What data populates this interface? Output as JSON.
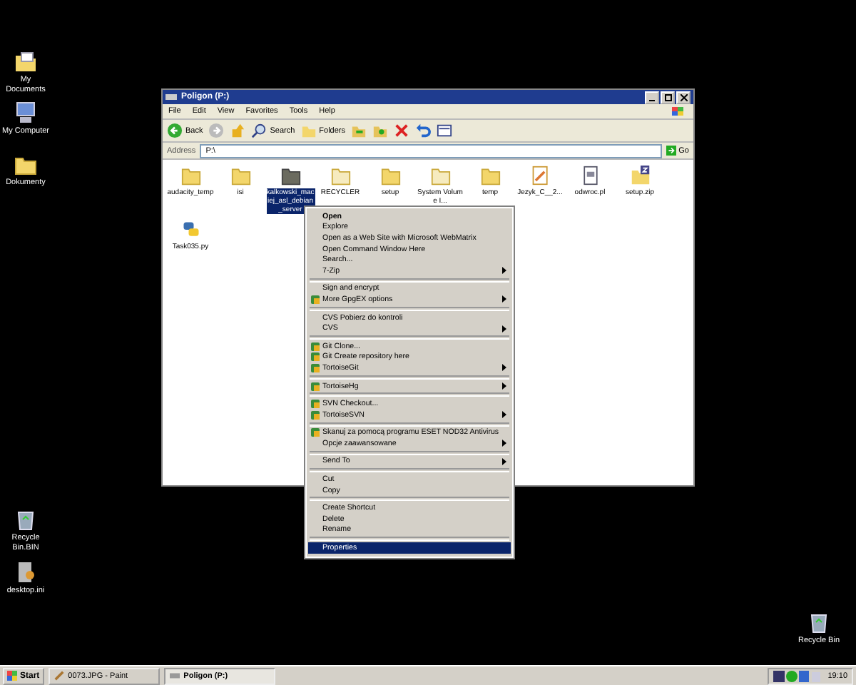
{
  "desktop_icons": [
    {
      "label": "My Documents",
      "kind": "documents"
    },
    {
      "label": "My Computer",
      "kind": "computer"
    },
    {
      "label": "Dokumenty",
      "kind": "folder"
    },
    {
      "label": "Recycle Bin.BIN",
      "kind": "bin"
    },
    {
      "label": "desktop.ini",
      "kind": "settings-file"
    },
    {
      "label": "Recycle Bin",
      "kind": "bin"
    }
  ],
  "window": {
    "title": "Poligon (P:)",
    "menu": [
      "File",
      "Edit",
      "View",
      "Favorites",
      "Tools",
      "Help"
    ],
    "toolbar": [
      {
        "kind": "back",
        "label": "Back"
      },
      {
        "kind": "forward"
      },
      {
        "kind": "up"
      },
      {
        "kind": "search",
        "label": "Search"
      },
      {
        "kind": "folders",
        "label": "Folders"
      },
      {
        "kind": "move"
      },
      {
        "kind": "copy"
      },
      {
        "kind": "delete"
      },
      {
        "kind": "undo"
      },
      {
        "kind": "views"
      }
    ],
    "address": {
      "label": "Address",
      "value": "P:\\",
      "go": "Go"
    },
    "files": [
      {
        "label": "audacity_temp",
        "kind": "folder",
        "selected": false
      },
      {
        "label": "isi",
        "kind": "folder",
        "selected": false
      },
      {
        "label": "kalkowski_maciej_asl_debian_server",
        "kind": "folder",
        "selected": true
      },
      {
        "label": "RECYCLER",
        "kind": "folder-faded",
        "selected": false
      },
      {
        "label": "setup",
        "kind": "folder",
        "selected": false
      },
      {
        "label": "System Volume I...",
        "kind": "folder-faded",
        "selected": false
      },
      {
        "label": "temp",
        "kind": "folder",
        "selected": false
      },
      {
        "label": "Jezyk_C__2...",
        "kind": "document",
        "selected": false
      },
      {
        "label": "odwroc.pl",
        "kind": "text",
        "selected": false
      },
      {
        "label": "setup.zip",
        "kind": "zip",
        "selected": false
      },
      {
        "label": "Task035.py",
        "kind": "python",
        "selected": false
      }
    ]
  },
  "context_menu": [
    {
      "kind": "item",
      "label": "Open",
      "bold": true,
      "selected": false
    },
    {
      "kind": "item",
      "label": "Explore",
      "selected": false
    },
    {
      "kind": "item",
      "label": "Open as a Web Site with Microsoft WebMatrix",
      "selected": false
    },
    {
      "kind": "item",
      "label": "Open Command Window Here",
      "selected": false
    },
    {
      "kind": "item",
      "label": "Search...",
      "selected": false
    },
    {
      "kind": "item",
      "label": "7-Zip",
      "submenu": true,
      "selected": false
    },
    {
      "kind": "separator"
    },
    {
      "kind": "item",
      "label": "Sign and encrypt",
      "selected": false
    },
    {
      "kind": "item",
      "label": "More GpgEX options",
      "submenu": true,
      "has_icon": true,
      "selected": false
    },
    {
      "kind": "separator"
    },
    {
      "kind": "item",
      "label": "CVS Pobierz do kontroli",
      "selected": false
    },
    {
      "kind": "item",
      "label": "CVS",
      "submenu": true,
      "selected": false
    },
    {
      "kind": "separator"
    },
    {
      "kind": "item",
      "label": "Git Clone...",
      "has_icon": true,
      "selected": false
    },
    {
      "kind": "item",
      "label": "Git Create repository here",
      "has_icon": true,
      "selected": false
    },
    {
      "kind": "item",
      "label": "TortoiseGit",
      "submenu": true,
      "has_icon": true,
      "selected": false
    },
    {
      "kind": "separator"
    },
    {
      "kind": "item",
      "label": "TortoiseHg",
      "submenu": true,
      "has_icon": true,
      "selected": false
    },
    {
      "kind": "separator"
    },
    {
      "kind": "item",
      "label": "SVN Checkout...",
      "has_icon": true,
      "selected": false
    },
    {
      "kind": "item",
      "label": "TortoiseSVN",
      "submenu": true,
      "has_icon": true,
      "selected": false
    },
    {
      "kind": "separator"
    },
    {
      "kind": "item",
      "label": "Skanuj za pomocą programu ESET NOD32 Antivirus",
      "has_icon": true,
      "selected": false
    },
    {
      "kind": "item",
      "label": "Opcje zaawansowane",
      "submenu": true,
      "selected": false
    },
    {
      "kind": "separator"
    },
    {
      "kind": "item",
      "label": "Send To",
      "submenu": true,
      "selected": false
    },
    {
      "kind": "separator"
    },
    {
      "kind": "item",
      "label": "Cut",
      "selected": false
    },
    {
      "kind": "item",
      "label": "Copy",
      "selected": false
    },
    {
      "kind": "separator"
    },
    {
      "kind": "item",
      "label": "Create Shortcut",
      "selected": false
    },
    {
      "kind": "item",
      "label": "Delete",
      "selected": false
    },
    {
      "kind": "item",
      "label": "Rename",
      "selected": false
    },
    {
      "kind": "separator"
    },
    {
      "kind": "item",
      "label": "Properties",
      "selected": true
    }
  ],
  "taskbar": {
    "start": "Start",
    "tasks": [
      {
        "label": "0073.JPG - Paint",
        "kind": "paint",
        "selected": false
      },
      {
        "label": "Poligon (P:)",
        "kind": "drive",
        "selected": true
      }
    ],
    "clock": "19:10"
  }
}
